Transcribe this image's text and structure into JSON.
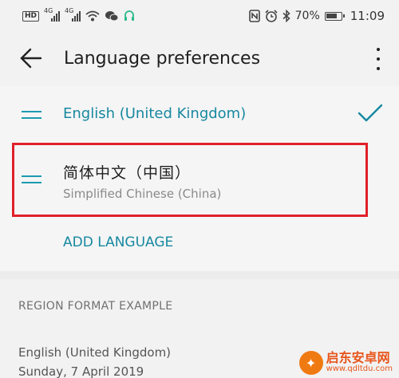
{
  "status_bar": {
    "network_badge": "HD",
    "signal1_label": "4G",
    "signal2_label": "4G",
    "battery": "70%",
    "time": "11:09",
    "icons": [
      "hd-icon",
      "signal-icon",
      "wifi-icon",
      "wechat-icon",
      "headset-icon",
      "nfc-icon",
      "alarm-icon",
      "bluetooth-icon",
      "battery-icon"
    ]
  },
  "app_bar": {
    "title": "Language preferences",
    "back_icon": "arrow-left-icon",
    "more_icon": "more-vertical-icon"
  },
  "languages": [
    {
      "label": "English (United Kingdom)",
      "sublabel": "",
      "selected": true
    },
    {
      "label": "简体中文（中国）",
      "sublabel": "Simplified Chinese (China)",
      "selected": false
    }
  ],
  "add_language_label": "ADD LANGUAGE",
  "region": {
    "header": "REGION FORMAT EXAMPLE",
    "example_locale": "English (United Kingdom)",
    "example_date": "Sunday, 7 April 2019"
  },
  "watermark": {
    "main": "启东安卓网",
    "url": "www.qdltdu.com"
  },
  "colors": {
    "accent": "#1788a0",
    "highlight_border": "#e0202a",
    "watermark": "#e8541a"
  }
}
